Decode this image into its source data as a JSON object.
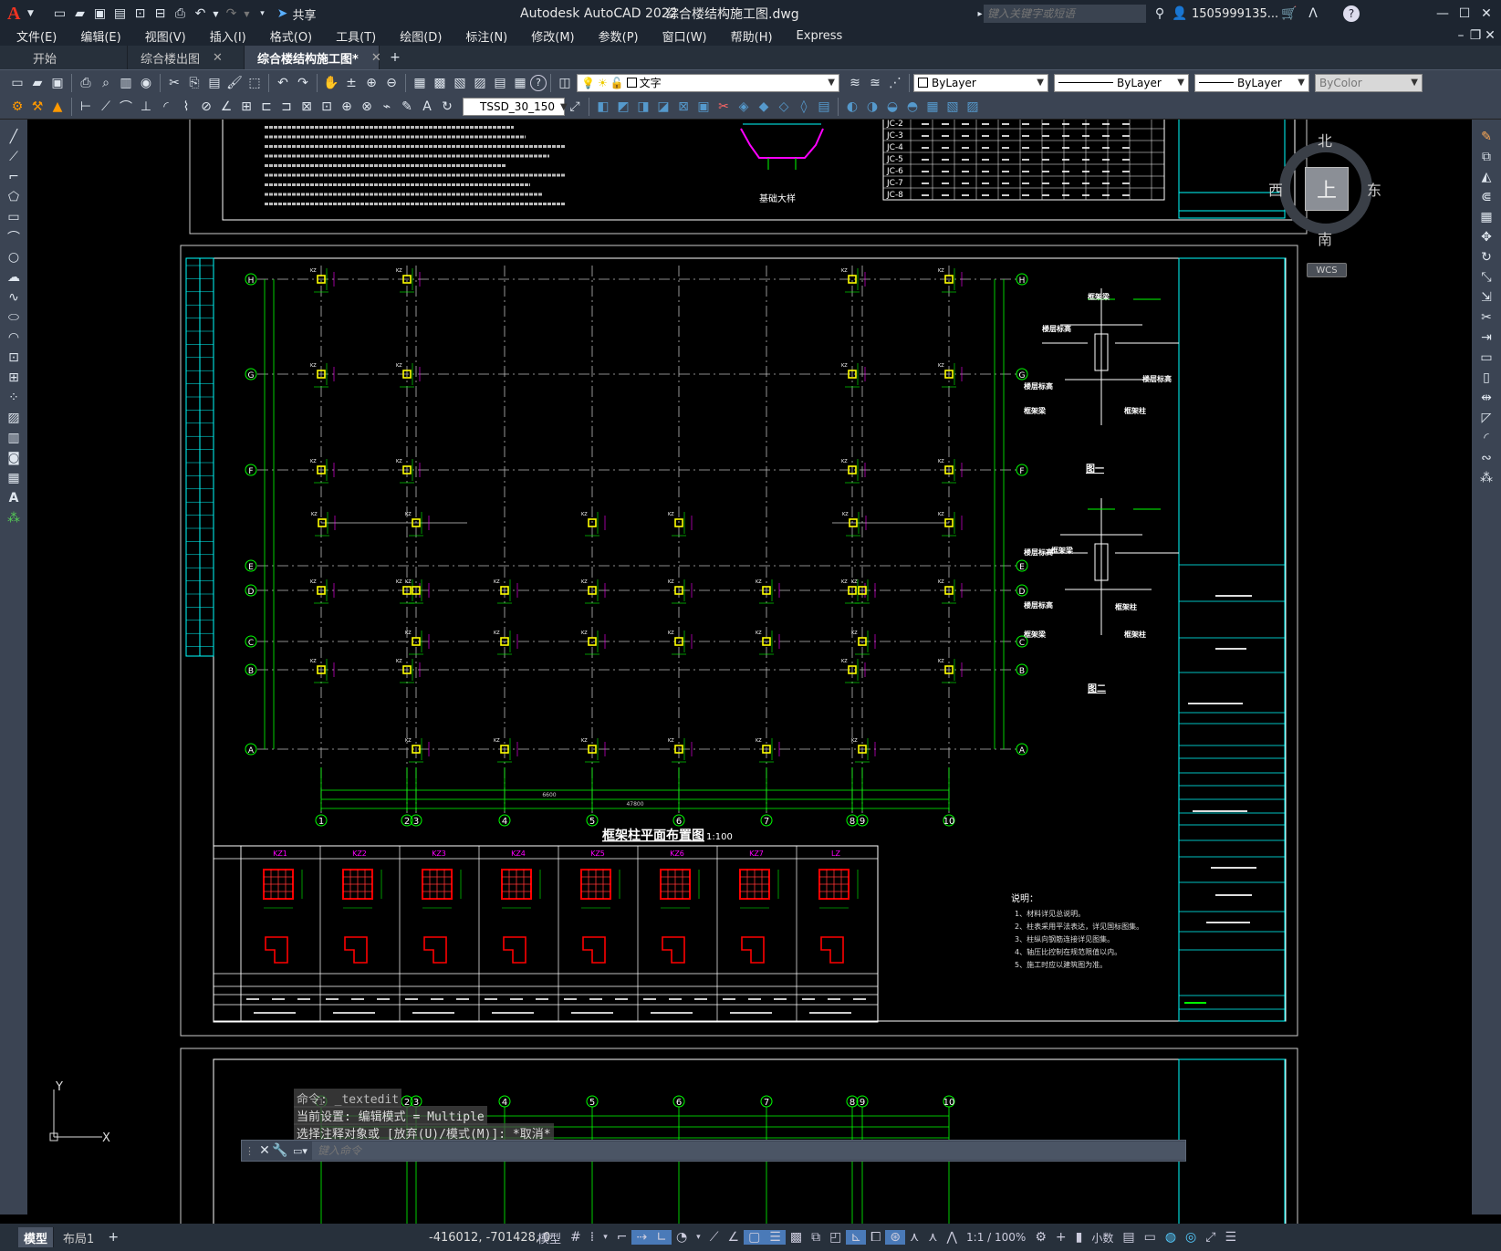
{
  "app": {
    "title": "Autodesk AutoCAD 2022",
    "filename": "综合楼结构施工图.dwg",
    "share": "共享",
    "search_placeholder": "键入关键字或短语",
    "user": "1505999135...",
    "logo": "A"
  },
  "menu": [
    "文件(E)",
    "编辑(E)",
    "视图(V)",
    "插入(I)",
    "格式(O)",
    "工具(T)",
    "绘图(D)",
    "标注(N)",
    "修改(M)",
    "参数(P)",
    "窗口(W)",
    "帮助(H)",
    "Express"
  ],
  "tabs": [
    {
      "label": "开始"
    },
    {
      "label": "综合楼出图"
    },
    {
      "label": "综合楼结构施工图*"
    }
  ],
  "toolbar": {
    "layer": "文字",
    "color": "ByLayer",
    "linetype": "ByLayer",
    "lineweight": "ByLayer",
    "plotstyle": "ByColor",
    "dimstyle": "TSSD_30_150"
  },
  "viewcube": {
    "north": "北",
    "south": "南",
    "east": "东",
    "west": "西",
    "face": "上",
    "wcs": "WCS"
  },
  "drawing": {
    "title": "框架柱平面布置图",
    "scale": "1:100",
    "row_axes": [
      "H",
      "G",
      "F",
      "E",
      "D",
      "C",
      "B",
      "A"
    ],
    "col_axes": [
      "1",
      "2",
      "3",
      "4",
      "5",
      "6",
      "7",
      "8",
      "9",
      "10"
    ],
    "total_dim": "47800",
    "dim_mid": "6600",
    "detail1": "图一",
    "detail2": "图二",
    "detail_labels": [
      "楼层标高",
      "框架梁",
      "楼层标高",
      "框架梁",
      "框架柱",
      "框架梁",
      "框架柱"
    ],
    "columns": [
      "KZ1",
      "KZ2",
      "KZ3",
      "KZ4",
      "KZ5",
      "KZ6",
      "KZ7",
      "LZ"
    ],
    "notes_title": "说明：",
    "notes": [
      "1、材料详见总说明。",
      "2、柱表采用平法表达，详见国标图集。",
      "3、柱纵向钢筋连接详见图集。",
      "4、轴压比控制在规范限值以内。",
      "5、施工时应以建筑图为准。"
    ],
    "top_table": [
      "JC-2",
      "JC-3",
      "JC-4",
      "JC-5",
      "JC-6",
      "JC-7",
      "JC-8"
    ]
  },
  "command": {
    "l1": "命令: _textedit",
    "l2": "当前设置: 编辑模式 = Multiple",
    "l3": "选择注释对象或 [放弃(U)/模式(M)]: *取消*",
    "placeholder": "键入命令"
  },
  "status": {
    "model_tab": "模型",
    "layout_tab": "布局1",
    "coords": "-416012, -701428, 0",
    "space": "模型",
    "scale": "1:1 / 100%",
    "units": "小数"
  }
}
